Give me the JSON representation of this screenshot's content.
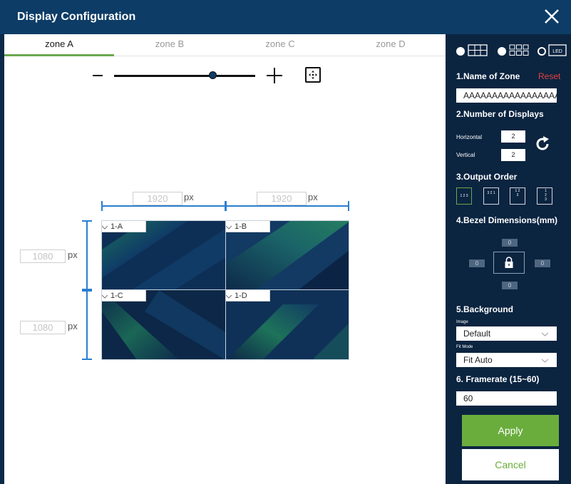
{
  "window": {
    "title": "Display Configuration"
  },
  "tabs": [
    {
      "label": "zone A",
      "active": true
    },
    {
      "label": "zone B",
      "active": false
    },
    {
      "label": "zone C",
      "active": false
    },
    {
      "label": "zone D",
      "active": false
    }
  ],
  "zoom": {
    "level": 0.7
  },
  "canvas": {
    "widths": [
      {
        "value": "1920",
        "unit": "px"
      },
      {
        "value": "1920",
        "unit": "px"
      }
    ],
    "heights": [
      {
        "value": "1080",
        "unit": "px"
      },
      {
        "value": "1080",
        "unit": "px"
      }
    ],
    "displays": [
      {
        "label": "1-A"
      },
      {
        "label": "1-B"
      },
      {
        "label": "1-C"
      },
      {
        "label": "1-D"
      }
    ]
  },
  "sidebar": {
    "layout_modes": [
      "grid-wide-icon",
      "grid-multi-icon",
      "led-icon"
    ],
    "led_label": "LED",
    "selected_mode": "led",
    "name_heading": "1.Name of Zone",
    "reset_label": "Reset",
    "zone_name": "AAAAAAAAAAAAAAAAAA",
    "displays_heading": "2.Number of Displays",
    "horizontal_label": "Horizontal",
    "horizontal_value": "2",
    "vertical_label": "Vertical",
    "vertical_value": "2",
    "order_heading": "3.Output Order",
    "order_options": [
      {
        "text": "1 2 3"
      },
      {
        "text": "3 2 1"
      },
      {
        "text": "1 2 3"
      },
      {
        "text": "1 2 3"
      }
    ],
    "bezel_heading": "4.Bezel Dimensions(mm)",
    "bezel": {
      "top": "0",
      "left": "0",
      "right": "0",
      "bottom": "0"
    },
    "background_heading": "5.Background",
    "image_label": "Image",
    "image_value": "Default",
    "fitmode_label": "Fit Mode",
    "fitmode_value": "Fit Auto",
    "framerate_heading": "6. Framerate (15~60)",
    "framerate_value": "60"
  },
  "actions": {
    "apply": "Apply",
    "cancel": "Cancel"
  },
  "colors": {
    "accent": "#6aad3d",
    "header": "#0d3c66",
    "sidebar": "#0b2440",
    "dimension": "#2a7fd0",
    "reset": "#e24040"
  }
}
